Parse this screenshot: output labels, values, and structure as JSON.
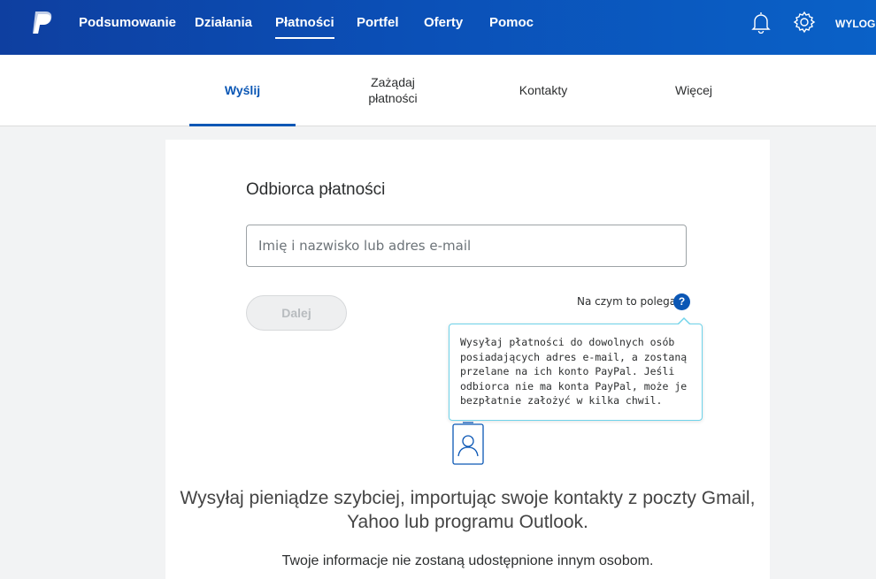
{
  "topnav": {
    "logo": "paypal-logo-icon",
    "items": [
      {
        "label": "Podsumowanie",
        "active": false
      },
      {
        "label": "Działania",
        "active": false
      },
      {
        "label": "Płatności",
        "active": true
      },
      {
        "label": "Portfel",
        "active": false
      },
      {
        "label": "Oferty",
        "active": false
      },
      {
        "label": "Pomoc",
        "active": false
      }
    ],
    "icons": [
      "bell-icon",
      "gear-icon"
    ],
    "logout_label": "WYLOG"
  },
  "subnav": {
    "tabs": [
      {
        "label": "Wyślij",
        "active": true
      },
      {
        "label": "Zażądaj płatności",
        "active": false
      },
      {
        "label": "Kontakty",
        "active": false
      },
      {
        "label": "Więcej",
        "active": false
      }
    ]
  },
  "form": {
    "heading": "Odbiorca płatności",
    "recipient_placeholder": "Imię i nazwisko lub adres e-mail",
    "recipient_value": "",
    "next_label": "Dalej",
    "help_link": "Na czym to polega",
    "help_icon": "?",
    "tooltip_text": "Wysyłaj płatności do dowolnych osób posiadających adres e-mail, a zostaną przelane na ich konto PayPal. Jeśli odbiorca nie ma konta PayPal, może je bezpłatnie założyć w kilka chwil."
  },
  "import": {
    "text": "Wysyłaj pieniądze szybciej, importując swoje kontakty z poczty Gmail, Yahoo lub programu Outlook.",
    "privacy": "Twoje informacje nie zostaną udostępnione innym osobom."
  },
  "colors": {
    "nav_gradient_start": "#0e3fa0",
    "nav_gradient_end": "#0a61c7",
    "accent_blue": "#0b57b5",
    "tooltip_border": "#6fd3ea"
  }
}
